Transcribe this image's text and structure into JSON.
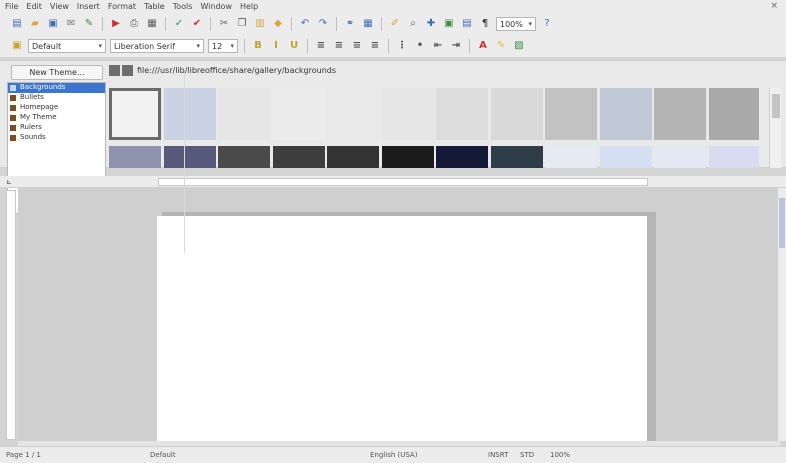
{
  "menu": [
    "File",
    "Edit",
    "View",
    "Insert",
    "Format",
    "Table",
    "Tools",
    "Window",
    "Help"
  ],
  "toolbar1": {
    "buttons": [
      {
        "name": "new-icon",
        "glyph": "▤",
        "color": "#3d6fb5"
      },
      {
        "name": "open-icon",
        "glyph": "▰",
        "color": "#d9a441"
      },
      {
        "name": "save-icon",
        "glyph": "▣",
        "color": "#3d6fb5"
      },
      {
        "name": "email-icon",
        "glyph": "✉",
        "color": "#7b7b7b"
      },
      {
        "name": "edit-icon",
        "glyph": "✎",
        "color": "#4b8a3c"
      },
      {
        "name": "export-pdf-icon",
        "glyph": "▶",
        "color": "#c8332f"
      },
      {
        "name": "print-icon",
        "glyph": "⎙",
        "color": "#5c5c5c"
      },
      {
        "name": "print-preview-icon",
        "glyph": "▦",
        "color": "#5c5c5c"
      },
      {
        "name": "spellcheck-icon",
        "glyph": "✓",
        "color": "#3c8c3c"
      },
      {
        "name": "autospell-icon",
        "glyph": "✔",
        "color": "#c8332f"
      },
      {
        "name": "cut-icon",
        "glyph": "✂",
        "color": "#5c5c5c"
      },
      {
        "name": "copy-icon",
        "glyph": "❐",
        "color": "#5c5c5c"
      },
      {
        "name": "paste-icon",
        "glyph": "▥",
        "color": "#d9a441"
      },
      {
        "name": "clone-format-icon",
        "glyph": "◆",
        "color": "#d9a441"
      },
      {
        "name": "undo-icon",
        "glyph": "↶",
        "color": "#3d6fb5"
      },
      {
        "name": "redo-icon",
        "glyph": "↷",
        "color": "#3d6fb5"
      },
      {
        "name": "hyperlink-icon",
        "glyph": "⚭",
        "color": "#3d6fb5"
      },
      {
        "name": "table-icon",
        "glyph": "▦",
        "color": "#3d6fb5"
      },
      {
        "name": "show-draw-icon",
        "glyph": "✐",
        "color": "#d9a441"
      },
      {
        "name": "find-icon",
        "glyph": "⌕",
        "color": "#5c5c5c"
      },
      {
        "name": "navigator-icon",
        "glyph": "✚",
        "color": "#3d6fb5"
      },
      {
        "name": "gallery-icon",
        "glyph": "▣",
        "color": "#3c8c3c"
      },
      {
        "name": "datasources-icon",
        "glyph": "▤",
        "color": "#3d6fb5"
      },
      {
        "name": "nonprinting-chars-icon",
        "glyph": "¶",
        "color": "#333333"
      }
    ],
    "zoom": "100%",
    "help_glyph": "?"
  },
  "toolbar2": {
    "style": "Default",
    "font": "Liberation Serif",
    "size": "12",
    "buttons": [
      {
        "name": "bold-icon",
        "glyph": "B",
        "color": "#c9a128"
      },
      {
        "name": "italic-icon",
        "glyph": "I",
        "color": "#c9a128"
      },
      {
        "name": "underline-icon",
        "glyph": "U",
        "color": "#c9a128"
      },
      {
        "name": "align-left-icon",
        "glyph": "≡",
        "color": "#555555"
      },
      {
        "name": "align-center-icon",
        "glyph": "≡",
        "color": "#555555"
      },
      {
        "name": "align-right-icon",
        "glyph": "≡",
        "color": "#555555"
      },
      {
        "name": "justify-icon",
        "glyph": "≡",
        "color": "#555555"
      },
      {
        "name": "numbering-icon",
        "glyph": "⋮",
        "color": "#555555"
      },
      {
        "name": "bullets-icon",
        "glyph": "•",
        "color": "#555555"
      },
      {
        "name": "decrease-indent-icon",
        "glyph": "⇤",
        "color": "#555555"
      },
      {
        "name": "increase-indent-icon",
        "glyph": "⇥",
        "color": "#555555"
      },
      {
        "name": "font-color-icon",
        "glyph": "A",
        "color": "#c8332f"
      },
      {
        "name": "highlight-icon",
        "glyph": "✎",
        "color": "#d9c22f"
      },
      {
        "name": "background-color-icon",
        "glyph": "▨",
        "color": "#3c8c3c"
      }
    ]
  },
  "gallery": {
    "new_theme_label": "New Theme...",
    "themes": [
      {
        "label": "Backgrounds",
        "selected": true
      },
      {
        "label": "Bullets",
        "selected": false
      },
      {
        "label": "Homepage",
        "selected": false
      },
      {
        "label": "My Theme",
        "selected": false
      },
      {
        "label": "Rulers",
        "selected": false
      },
      {
        "label": "Sounds",
        "selected": false
      }
    ],
    "path": "file:///usr/lib/libreoffice/share/gallery/backgrounds",
    "thumbnails_row1": [
      "#f2f2f2",
      "#c9d3e3",
      "#e6e6e6",
      "#ececec",
      "#e9e9e9",
      "#e6e6e6",
      "#dddddd",
      "#d9d9d9",
      "#c2c2c2",
      "#bfcad6",
      "#b4b4b4",
      "#a9a9a9"
    ],
    "thumbnails_row2": [
      "#8f93ad",
      "#555a7a",
      "#4a4a4a",
      "#3e3e3e",
      "#333333",
      "#1c1c1c",
      "#151a38",
      "#2e3d48",
      "#e6ebf3",
      "#d6e0f3",
      "#e4e8f2",
      "#d9dcf0"
    ],
    "selected_index": 0
  },
  "ruler": {
    "corner": "⊾"
  },
  "status": {
    "page": "Page 1 / 1",
    "style": "Default",
    "language": "English (USA)",
    "mode": "INSRT",
    "std": "STD",
    "zoom": "100%"
  }
}
